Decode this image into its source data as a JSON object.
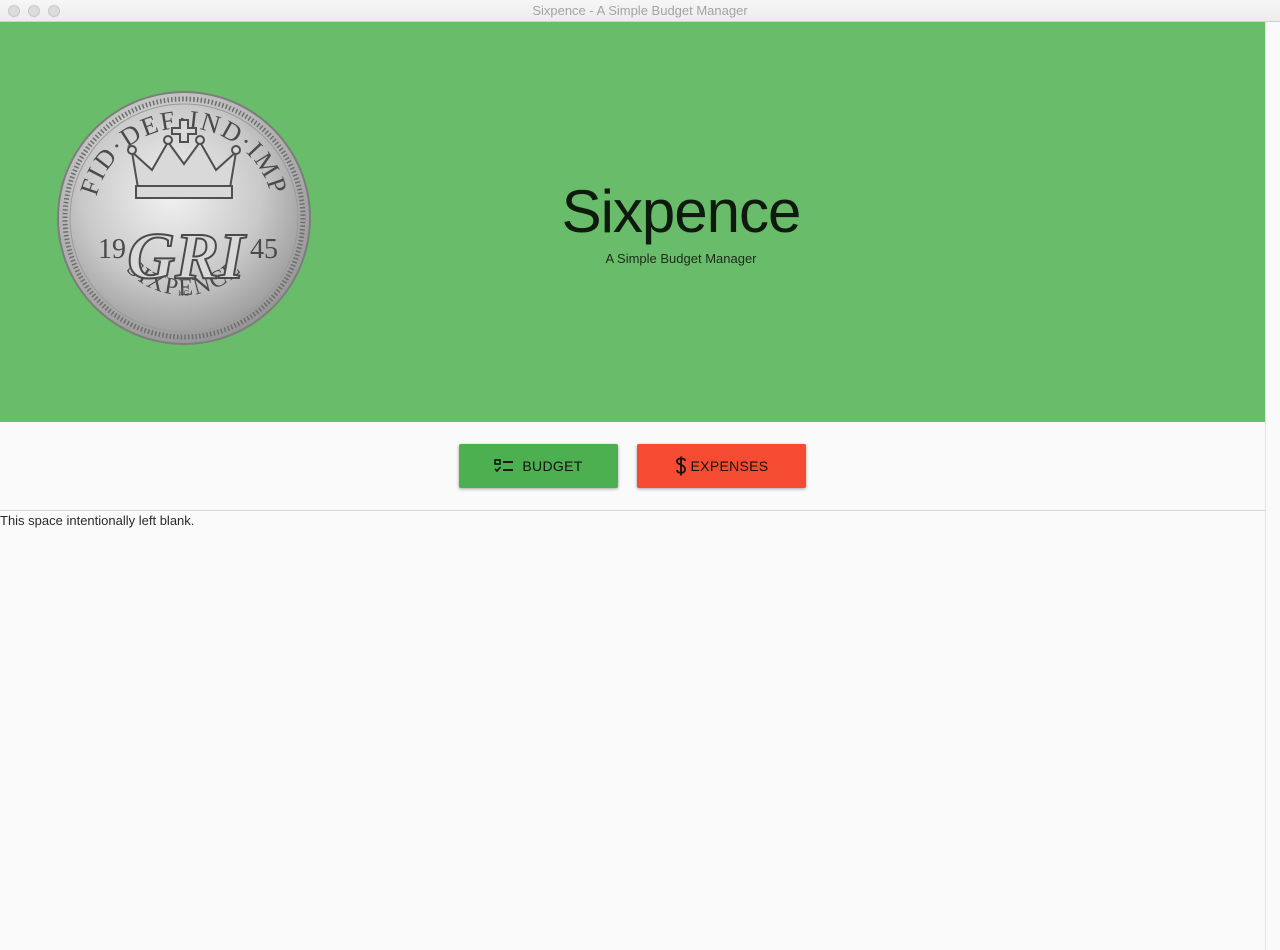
{
  "window": {
    "title": "Sixpence - A Simple Budget Manager"
  },
  "hero": {
    "title": "Sixpence",
    "subtitle": "A Simple Budget Manager",
    "background_color": "#69bc69",
    "coin": {
      "top_text": "FID·DEF·IND·IMP",
      "monogram": "GRI",
      "year_left": "19",
      "year_right": "45",
      "bottom_text": "SIXPENCE",
      "initials": "KG"
    }
  },
  "nav": {
    "budget": {
      "label": "BUDGET",
      "icon": "checklist-icon",
      "color": "#4caf50"
    },
    "expenses": {
      "label": "EXPENSES",
      "icon": "dollar-icon",
      "color": "#f44b32"
    }
  },
  "main": {
    "placeholder_text": "This space intentionally left blank."
  }
}
